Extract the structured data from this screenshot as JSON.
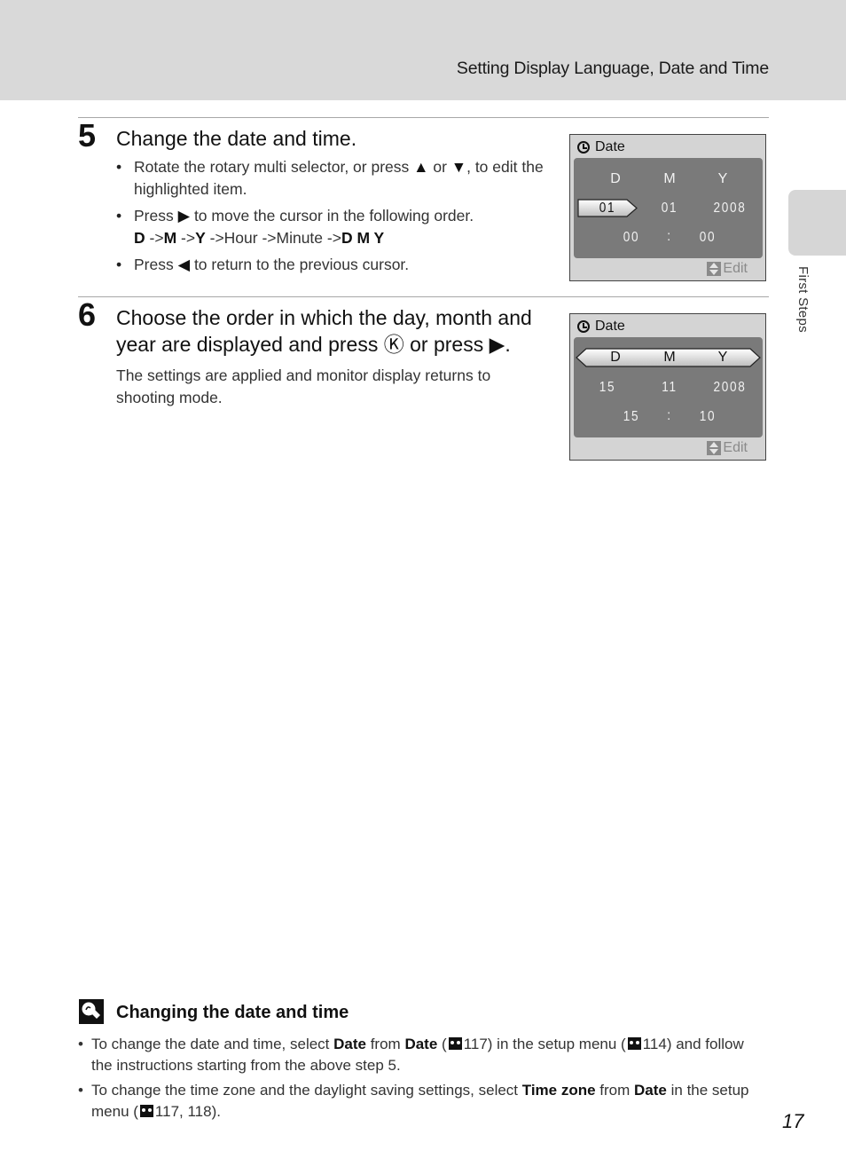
{
  "header": {
    "title": "Setting Display Language, Date and Time"
  },
  "side_tab": {
    "label": "First Steps"
  },
  "step5": {
    "number": "5",
    "title": "Change the date and time.",
    "bullets": [
      {
        "pre": "Rotate the rotary multi selector, or press ",
        "up": "▲",
        "mid": " or ",
        "down": "▼",
        "post": ", to edit the highlighted item."
      },
      {
        "pre": "Press ",
        "right": "▶",
        "post": " to move the cursor in the following order.",
        "order": {
          "d": "D",
          "sep1": " ->",
          "m": "M",
          "sep2": " ->",
          "y": "Y",
          "rest": " ->Hour ->Minute ->",
          "dmy": "D M Y"
        }
      },
      {
        "pre": "Press ",
        "left": "◀",
        "post": " to return to the previous cursor."
      }
    ]
  },
  "step6": {
    "number": "6",
    "title_pre": "Choose the order in which the day, month and year are displayed and press ",
    "ok": "Ⓚ",
    "title_mid": " or press ",
    "right": "▶",
    "title_post": ".",
    "body": "The settings are applied and monitor display returns to shooting mode."
  },
  "screen1": {
    "title": "Date",
    "headers": [
      "D",
      "M",
      "Y"
    ],
    "date": [
      "01",
      "01",
      "2008"
    ],
    "time": [
      "00",
      ":",
      "00"
    ],
    "edit": "Edit",
    "highlighted": "day"
  },
  "screen2": {
    "title": "Date",
    "headers": [
      "D",
      "M",
      "Y"
    ],
    "date": [
      "15",
      "11",
      "2008"
    ],
    "time": [
      "15",
      ":",
      "10"
    ],
    "edit": "Edit",
    "highlighted": "order"
  },
  "tip": {
    "title": "Changing the date and time",
    "items": [
      {
        "t1": "To change the date and time, select ",
        "b1": "Date",
        "t2": " from ",
        "b2": "Date",
        "t3": " (",
        "r1": "117",
        "t4": ") in the setup menu (",
        "r2": "114",
        "t5": ") and follow the instructions starting from the above step 5."
      },
      {
        "t1": "To change the time zone and the daylight saving settings, select ",
        "b1": "Time zone",
        "t2": " from ",
        "b2": "Date",
        "t3": " in the setup menu (",
        "r1": "117, 118",
        "t4": ")."
      }
    ]
  },
  "page_number": "17"
}
